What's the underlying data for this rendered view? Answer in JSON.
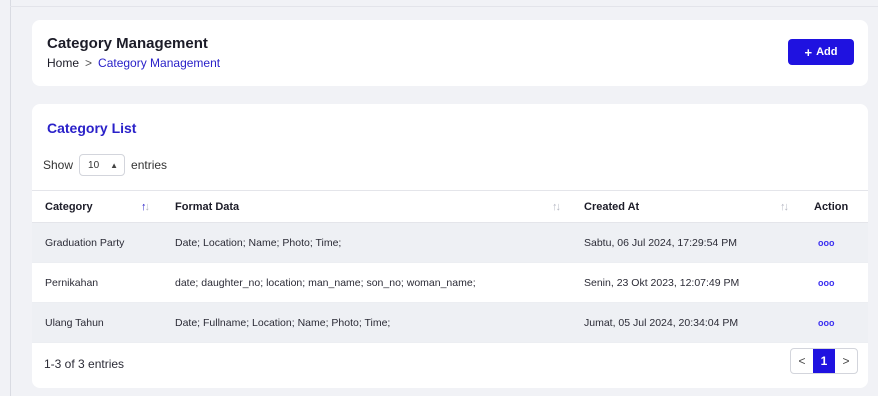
{
  "header": {
    "title": "Category Management",
    "breadcrumb": {
      "home": "Home",
      "separator": ">",
      "current": "Category Management"
    },
    "add_icon": "plus-icon",
    "add_icon_glyph": "+",
    "add_label": "Add"
  },
  "list": {
    "title": "Category List",
    "show_label": "Show",
    "page_size": "10",
    "entries_label": "entries",
    "columns": {
      "category": "Category",
      "format_data": "Format Data",
      "created_at": "Created At",
      "action": "Action"
    },
    "rows": [
      {
        "category": "Graduation Party",
        "format_data": "Date; Location; Name; Photo; Time;",
        "created_at": "Sabtu, 06 Jul 2024, 17:29:54 PM",
        "action": "ooo"
      },
      {
        "category": "Pernikahan",
        "format_data": "date; daughter_no; location; man_name; son_no; woman_name;",
        "created_at": "Senin, 23 Okt 2023, 12:07:49 PM",
        "action": "ooo"
      },
      {
        "category": "Ulang Tahun",
        "format_data": "Date; Fullname; Location; Name; Photo; Time;",
        "created_at": "Jumat, 05 Jul 2024, 20:34:04 PM",
        "action": "ooo"
      }
    ],
    "footer": "1-3 of 3 entries",
    "pagination": {
      "prev": "<",
      "current": "1",
      "next": ">"
    }
  },
  "colors": {
    "accent": "#1f12e0",
    "link": "#2a21c9",
    "background": "#f1f2f6",
    "row_shade": "#eef0f4"
  }
}
